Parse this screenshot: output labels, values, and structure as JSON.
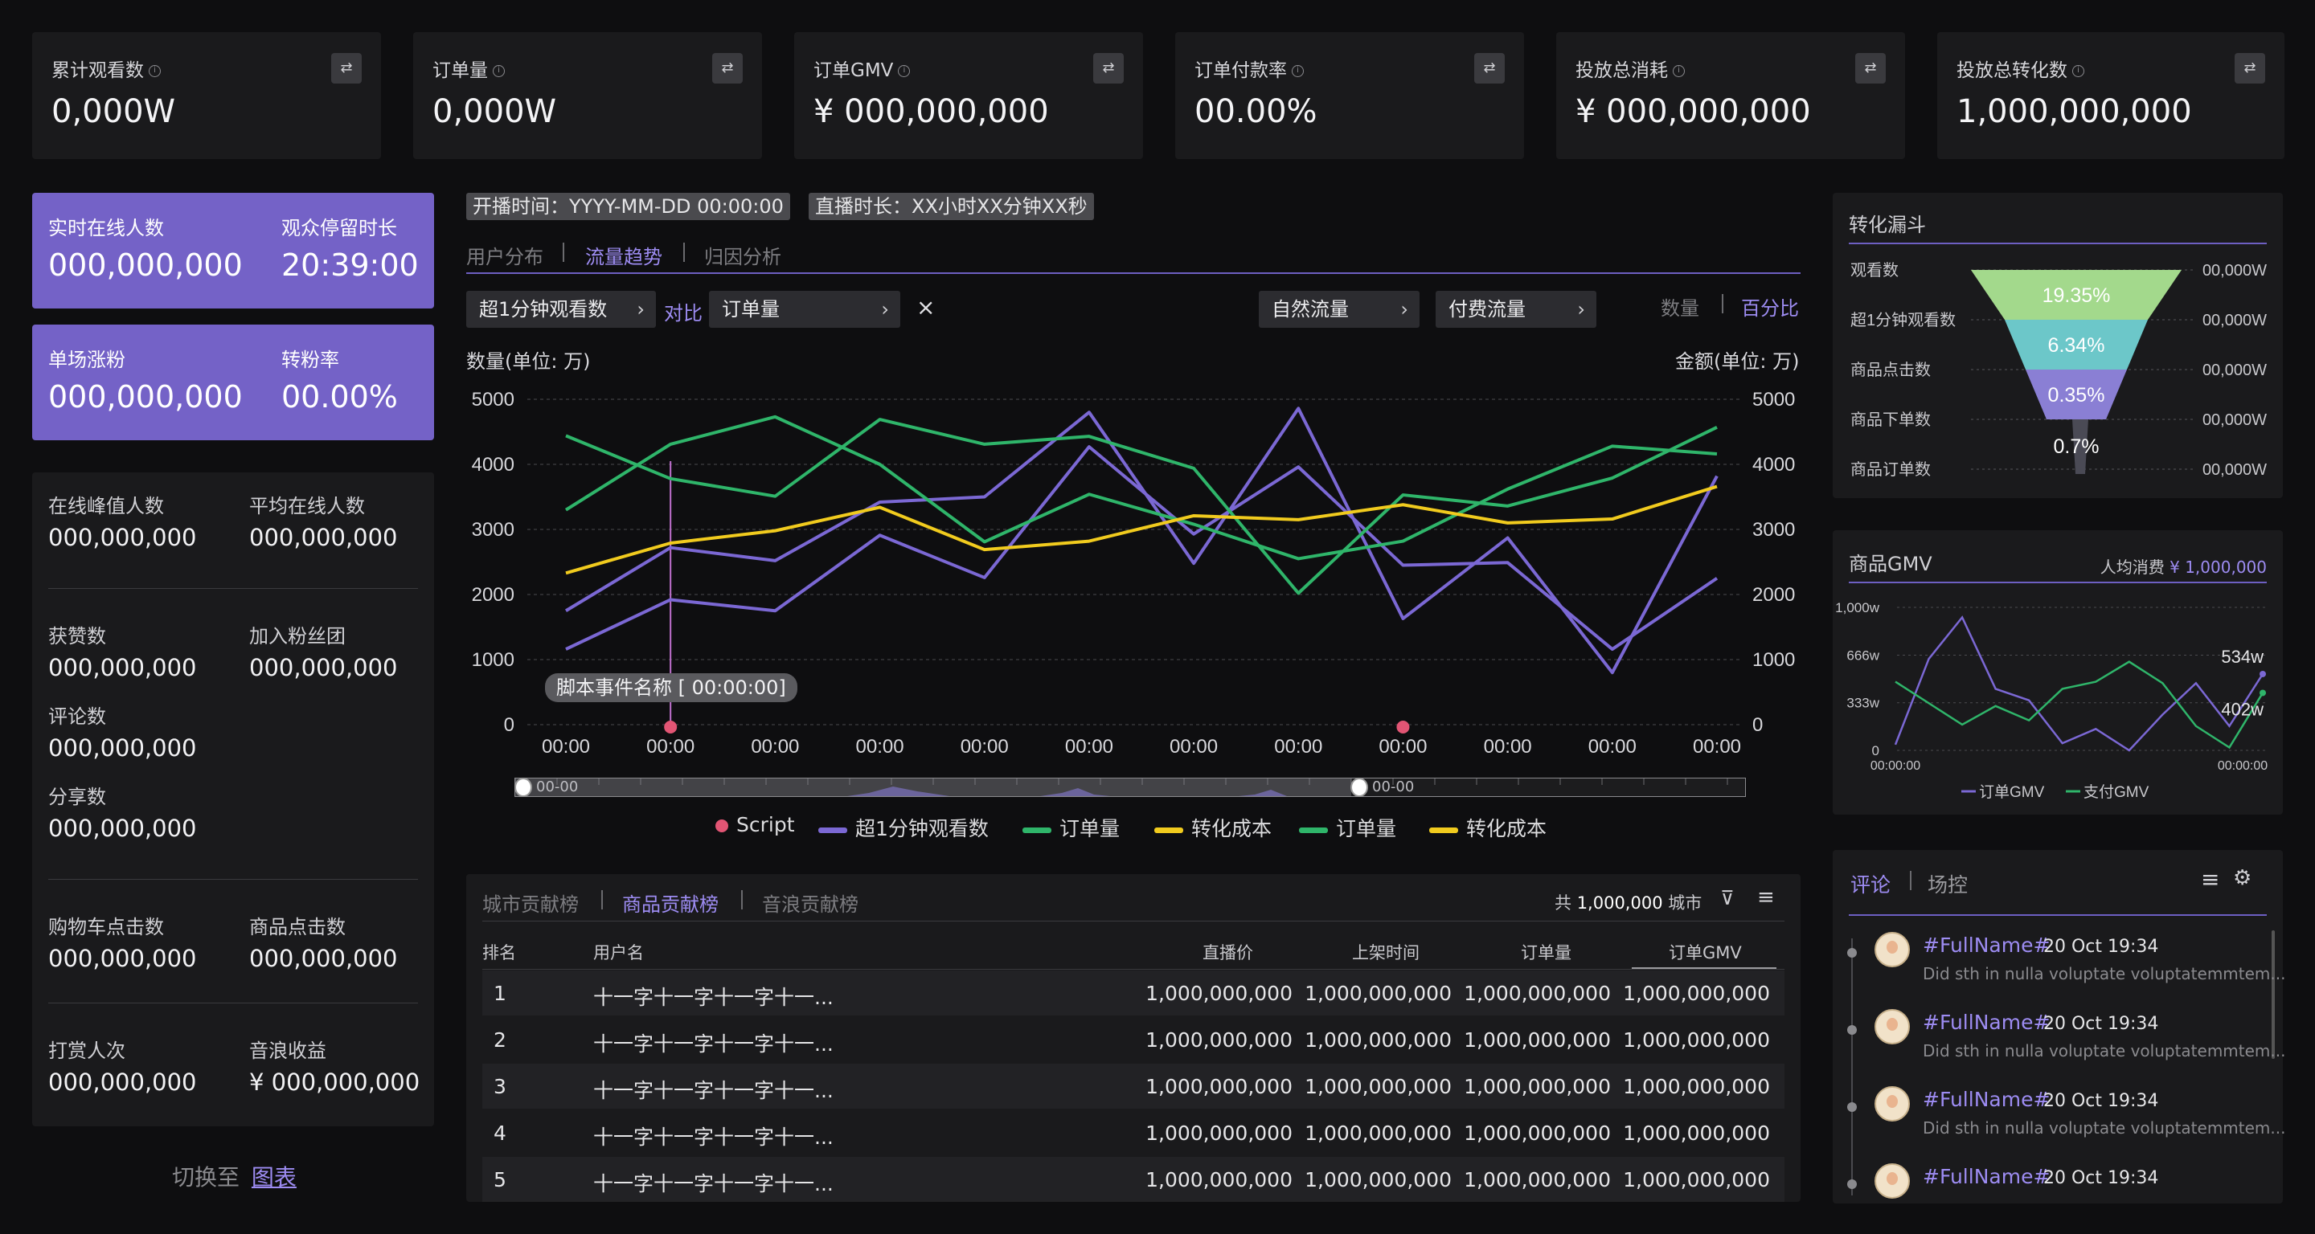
{
  "kpis": [
    {
      "label": "累计观看数",
      "value": "0,000W"
    },
    {
      "label": "订单量",
      "value": "0,000W"
    },
    {
      "label": "订单GMV",
      "value": "¥ 000,000,000"
    },
    {
      "label": "订单付款率",
      "value": "00.00%"
    },
    {
      "label": "投放总消耗",
      "value": "¥ 000,000,000"
    },
    {
      "label": "投放总转化数",
      "value": "1,000,000,000"
    }
  ],
  "live": {
    "online_label": "实时在线人数",
    "online_value": "000,000,000",
    "stay_label": "观众停留时长",
    "stay_value": "20:39:00",
    "fans_label": "单场涨粉",
    "fans_value": "000,000,000",
    "rate_label": "转粉率",
    "rate_value": "00.00%"
  },
  "stats": {
    "peak_label": "在线峰值人数",
    "peak_value": "000,000,000",
    "avg_label": "平均在线人数",
    "avg_value": "000,000,000",
    "likes_label": "获赞数",
    "likes_value": "000,000,000",
    "fanclub_label": "加入粉丝团",
    "fanclub_value": "000,000,000",
    "comments_label": "评论数",
    "comments_value": "000,000,000",
    "shares_label": "分享数",
    "shares_value": "000,000,000",
    "cart_label": "购物车点击数",
    "cart_value": "000,000,000",
    "product_label": "商品点击数",
    "product_value": "000,000,000",
    "tip_label": "打赏人次",
    "tip_value": "000,000,000",
    "wave_label": "音浪收益",
    "wave_value": "¥ 000,000,000"
  },
  "switch": {
    "prefix": "切换至",
    "link": "图表"
  },
  "broadcast": {
    "start": "开播时间：YYYY-MM-DD 00:00:00",
    "duration": "直播时长：XX小时XX分钟XX秒"
  },
  "tabs": [
    "用户分布",
    "流量趋势",
    "归因分析"
  ],
  "filters": {
    "metric1": "超1分钟观看数",
    "compare": "对比",
    "metric2": "订单量",
    "clear": "×",
    "natural": "自然流量",
    "paid": "付费流量",
    "count": "数量",
    "percent": "百分比"
  },
  "chart_data": {
    "type": "line",
    "ylabel": "数量(单位: 万)",
    "y2label": "金额(单位: 万)",
    "ylim": [
      0,
      5000
    ],
    "yticks": [
      "0",
      "1000",
      "2000",
      "3000",
      "4000",
      "5000"
    ],
    "categories": [
      "00:00",
      "00:00",
      "00:00",
      "00:00",
      "00:00",
      "00:00",
      "00:00",
      "00:00",
      "00:00",
      "00:00",
      "00:00",
      "00:00"
    ],
    "series": [
      {
        "name": "超1分钟观看数",
        "color": "#7b68d4",
        "values": [
          1750,
          2720,
          2520,
          3420,
          3500,
          4800,
          2480,
          4860,
          1630,
          2870,
          800,
          3820
        ]
      },
      {
        "name": "超1分钟观看数",
        "color": "#7b68d4",
        "values": [
          1160,
          1920,
          1750,
          2910,
          2260,
          4270,
          2930,
          3960,
          2450,
          2490,
          1160,
          2250
        ]
      },
      {
        "name": "订单量",
        "color": "#2fb56a",
        "values": [
          4440,
          3780,
          3510,
          4690,
          4310,
          4430,
          3940,
          2020,
          3530,
          3360,
          3790,
          4570
        ]
      },
      {
        "name": "订单量",
        "color": "#2fb56a",
        "values": [
          3300,
          4310,
          4730,
          4000,
          2810,
          3540,
          3080,
          2550,
          2820,
          3620,
          4280,
          4160
        ]
      },
      {
        "name": "转化成本",
        "color": "#f1cb1e",
        "values": [
          2330,
          2790,
          2980,
          3340,
          2690,
          2820,
          3210,
          3150,
          3380,
          3100,
          3160,
          3660
        ]
      }
    ],
    "event": {
      "label": "脚本事件名称 [ 00:00:00]",
      "index": 1
    },
    "script_points": [
      1,
      8
    ],
    "slider": {
      "start": "00-00",
      "end": "00-00"
    },
    "legend": [
      {
        "name": "Script",
        "color": "#e25574",
        "shape": "dot"
      },
      {
        "name": "超1分钟观看数",
        "color": "#7b68d4",
        "shape": "line"
      },
      {
        "name": "订单量",
        "color": "#2fb56a",
        "shape": "line"
      },
      {
        "name": "转化成本",
        "color": "#f1cb1e",
        "shape": "line"
      },
      {
        "name": "订单量",
        "color": "#2fb56a",
        "shape": "line"
      },
      {
        "name": "转化成本",
        "color": "#f1cb1e",
        "shape": "line"
      }
    ]
  },
  "rank": {
    "tabs": [
      "城市贡献榜",
      "商品贡献榜",
      "音浪贡献榜"
    ],
    "total_prefix": "共",
    "total_value": "1,000,000",
    "total_suffix": "城市",
    "columns": [
      "排名",
      "用户名",
      "直播价",
      "上架时间",
      "订单量",
      "订单GMV"
    ],
    "rows": [
      [
        "1",
        "十一字十一字十一字十一...",
        "1,000,000,000",
        "1,000,000,000",
        "1,000,000,000",
        "1,000,000,000"
      ],
      [
        "2",
        "十一字十一字十一字十一...",
        "1,000,000,000",
        "1,000,000,000",
        "1,000,000,000",
        "1,000,000,000"
      ],
      [
        "3",
        "十一字十一字十一字十一...",
        "1,000,000,000",
        "1,000,000,000",
        "1,000,000,000",
        "1,000,000,000"
      ],
      [
        "4",
        "十一字十一字十一字十一...",
        "1,000,000,000",
        "1,000,000,000",
        "1,000,000,000",
        "1,000,000,000"
      ],
      [
        "5",
        "十一字十一字十一字十一...",
        "1,000,000,000",
        "1,000,000,000",
        "1,000,000,000",
        "1,000,000,000"
      ]
    ]
  },
  "funnel": {
    "title": "转化漏斗",
    "stages": [
      {
        "label": "观看数",
        "value": "00,000W",
        "pct": "19.35%"
      },
      {
        "label": "超1分钟观看数",
        "value": "00,000W",
        "pct": "6.34%"
      },
      {
        "label": "商品点击数",
        "value": "00,000W",
        "pct": "0.35%"
      },
      {
        "label": "商品下单数",
        "value": "00,000W",
        "pct": "0.7%"
      },
      {
        "label": "商品订单数",
        "value": "00,000W",
        "pct": ""
      }
    ],
    "colors": [
      "#a3d98c",
      "#6cc7c9",
      "#8a7fd4",
      "#4a4a55"
    ]
  },
  "gmv": {
    "title": "商品GMV",
    "avg_label": "人均消费",
    "avg_value": "¥ 1,000,000",
    "chart_data": {
      "type": "line",
      "yticks": [
        "0",
        "333w",
        "666w",
        "1,000w"
      ],
      "ylim": [
        0,
        1000
      ],
      "xlabels": [
        "00:00:00",
        "00:00:00"
      ],
      "series": [
        {
          "name": "订单GMV",
          "color": "#7b68d4",
          "values": [
            40,
            640,
            930,
            430,
            350,
            50,
            150,
            0,
            250,
            470,
            170,
            534
          ]
        },
        {
          "name": "支付GMV",
          "color": "#2fb56a",
          "values": [
            480,
            330,
            180,
            310,
            210,
            430,
            480,
            620,
            470,
            170,
            20,
            402
          ]
        }
      ],
      "end_labels": [
        "534w",
        "402w"
      ]
    }
  },
  "comments": {
    "tabs": [
      "评论",
      "场控"
    ],
    "items": [
      {
        "name": "#FullName#",
        "date": "20 Oct",
        "time": "19:34",
        "text": "Did sth in nulla voluptate voluptatemmtem..."
      },
      {
        "name": "#FullName#",
        "date": "20 Oct",
        "time": "19:34",
        "text": "Did sth in nulla voluptate voluptatemmtem..."
      },
      {
        "name": "#FullName#",
        "date": "20 Oct",
        "time": "19:34",
        "text": "Did sth in nulla voluptate voluptatemmtem..."
      },
      {
        "name": "#FullName#",
        "date": "20 Oct",
        "time": "19:34",
        "text": ""
      }
    ]
  }
}
